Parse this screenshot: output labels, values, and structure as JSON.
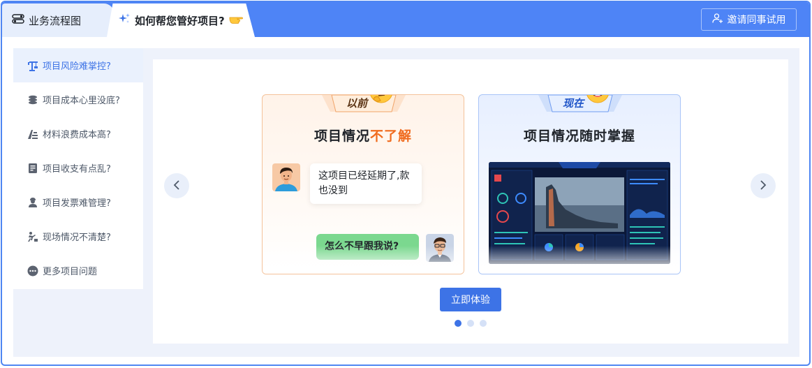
{
  "tabs": [
    {
      "label": "业务流程图",
      "icon": "toggle-icon"
    },
    {
      "label": "如何帮您管好项目?",
      "icon": "sparkle-icon",
      "trailing_icon": "pointing-hand-icon"
    }
  ],
  "header": {
    "invite_label": "邀请同事试用",
    "invite_icon": "add-user-icon"
  },
  "sidebar": {
    "items": [
      {
        "label": "项目风险难掌控?",
        "icon": "crane-icon",
        "active": true
      },
      {
        "label": "项目成本心里没底?",
        "icon": "coins-icon"
      },
      {
        "label": "材料浪费成本高?",
        "icon": "materials-icon"
      },
      {
        "label": "项目收支有点乱?",
        "icon": "ledger-icon"
      },
      {
        "label": "项目发票难管理?",
        "icon": "person-icon"
      },
      {
        "label": "现场情况不清楚?",
        "icon": "worker-icon"
      },
      {
        "label": "更多项目问题",
        "icon": "more-icon"
      }
    ]
  },
  "cards": {
    "before": {
      "ribbon": "以前",
      "title_prefix": "项目情况",
      "title_highlight": "不了解",
      "chat": [
        {
          "text": "这项目已经延期了,款也没到",
          "side": "left"
        },
        {
          "text": "怎么不早跟我说?",
          "side": "right"
        }
      ]
    },
    "now": {
      "ribbon": "现在",
      "title": "项目情况随时掌握",
      "dashboard_icon": "dashboard-screenshot"
    }
  },
  "cta": {
    "label": "立即体验"
  },
  "carousel": {
    "pages": 3,
    "current": 1
  },
  "colors": {
    "brand": "#4e84f6",
    "accent": "#3d73e6",
    "highlight": "#f06b1e",
    "bubble_green": "#7bd88f"
  }
}
